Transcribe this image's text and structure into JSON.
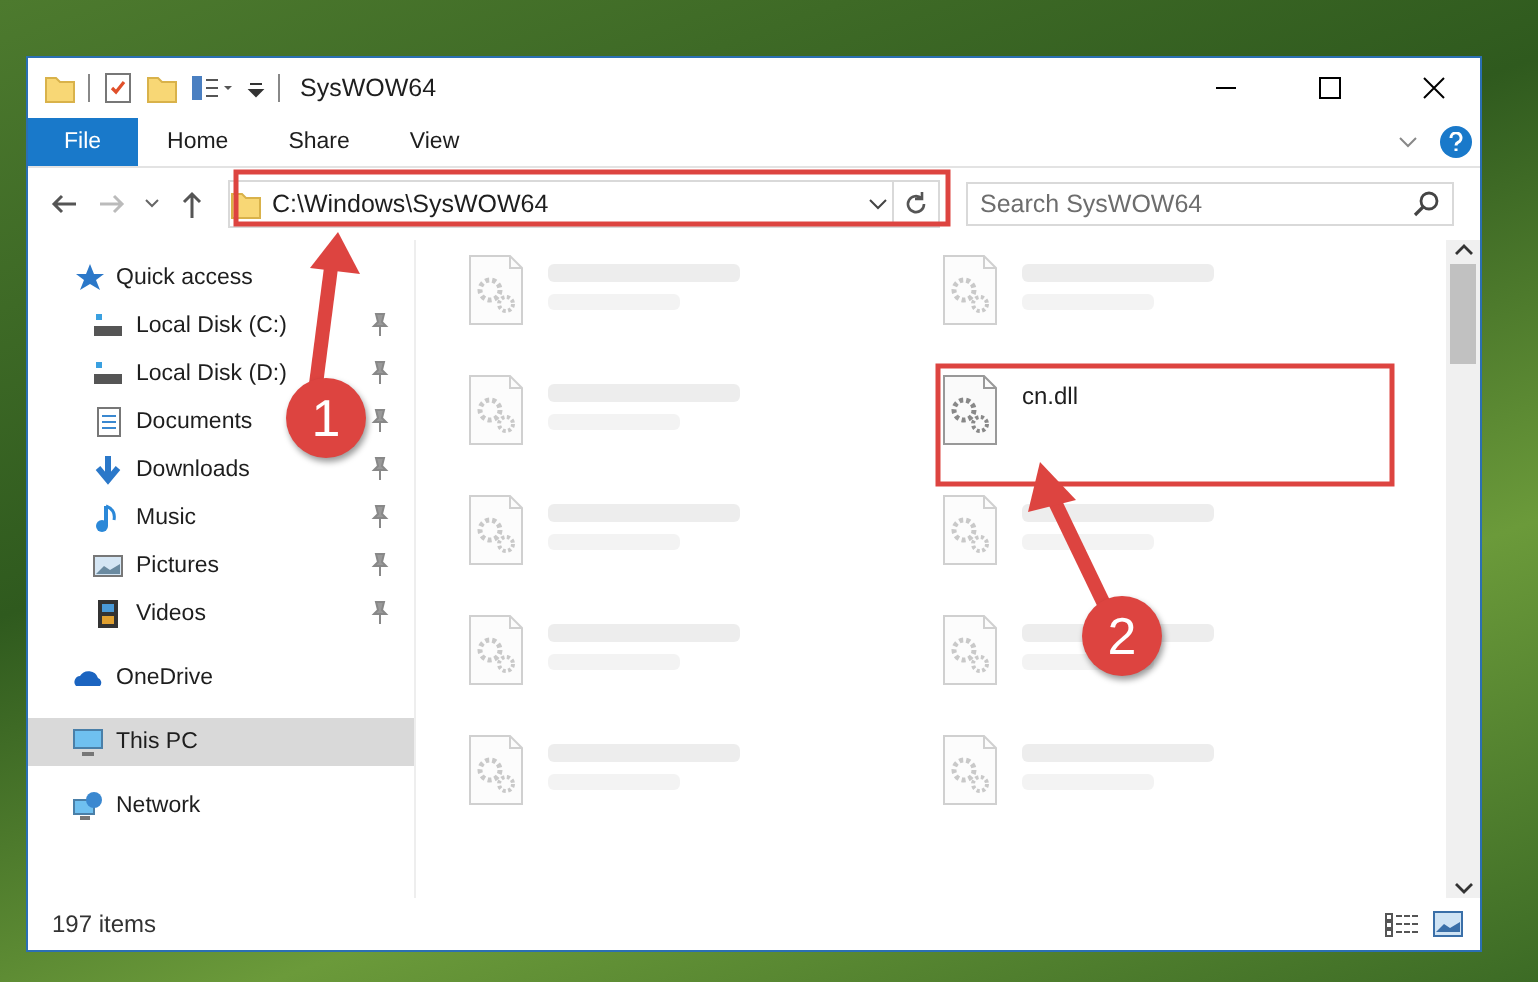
{
  "window": {
    "title": "SysWOW64"
  },
  "ribbon_tabs": [
    {
      "label": "File",
      "selected": true
    },
    {
      "label": "Home",
      "selected": false
    },
    {
      "label": "Share",
      "selected": false
    },
    {
      "label": "View",
      "selected": false
    }
  ],
  "address_bar": {
    "value": "C:\\Windows\\SysWOW64"
  },
  "search": {
    "placeholder": "Search SysWOW64"
  },
  "sidebar": {
    "items": [
      {
        "label": "Quick access",
        "kind": "star",
        "selected": false,
        "children": [
          {
            "label": "Local Disk (C:)",
            "kind": "drive",
            "selected": false,
            "pinned": true
          },
          {
            "label": "Local Disk (D:)",
            "kind": "drive",
            "selected": false,
            "pinned": true
          },
          {
            "label": "Documents",
            "kind": "documents",
            "selected": false,
            "pinned": true
          },
          {
            "label": "Downloads",
            "kind": "downloads",
            "selected": false,
            "pinned": true
          },
          {
            "label": "Music",
            "kind": "music",
            "selected": false,
            "pinned": true
          },
          {
            "label": "Pictures",
            "kind": "pictures",
            "selected": false,
            "pinned": true
          },
          {
            "label": "Videos",
            "kind": "videos",
            "selected": false,
            "pinned": true
          }
        ]
      },
      {
        "label": "OneDrive",
        "kind": "cloud",
        "selected": false
      },
      {
        "label": "This PC",
        "kind": "pc",
        "selected": true
      },
      {
        "label": "Network",
        "kind": "network",
        "selected": false
      }
    ]
  },
  "files": [
    {
      "blurred": true
    },
    {
      "blurred": true
    },
    {
      "blurred": true
    },
    {
      "name": "cn.dll",
      "blurred": false
    },
    {
      "blurred": true
    },
    {
      "blurred": true
    },
    {
      "blurred": true
    },
    {
      "blurred": true
    },
    {
      "blurred": true
    },
    {
      "blurred": true
    }
  ],
  "status_bar": {
    "item_count": "197 items"
  },
  "annotations": [
    {
      "number": "1"
    },
    {
      "number": "2"
    }
  ]
}
